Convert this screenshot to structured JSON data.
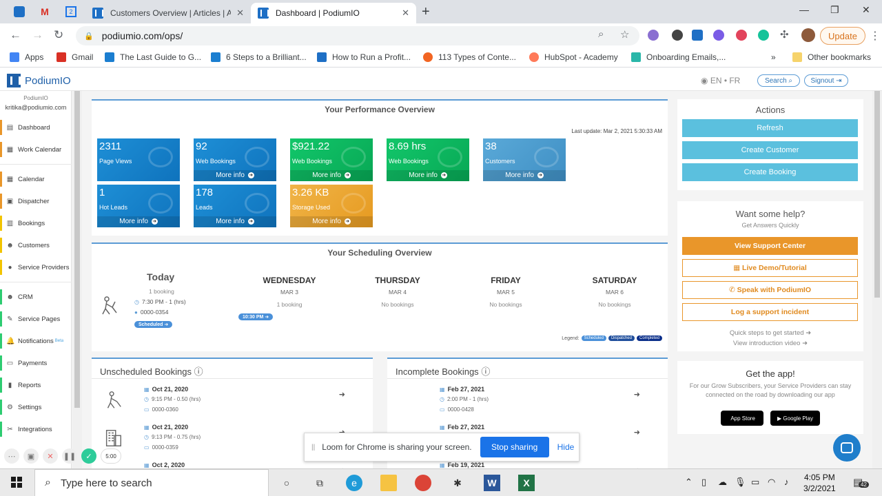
{
  "browser": {
    "tabs": [
      {
        "title": "Customers Overview | Articles | A"
      },
      {
        "title": "Dashboard | PodiumIO"
      }
    ],
    "url": "podiumio.com/ops/",
    "update_label": "Update",
    "bookmarks": [
      "Apps",
      "Gmail",
      "The Last Guide to G...",
      "6 Steps to a Brilliant...",
      "How to Run a Profit...",
      "113 Types of Conte...",
      "HubSpot - Academy",
      "Onboarding Emails,...",
      "Other bookmarks"
    ]
  },
  "app": {
    "logo": "PodiumIO",
    "lang": "EN • FR",
    "search_label": "Search",
    "signout_label": "Signout"
  },
  "sidebar": {
    "org": "PodiumIO",
    "email": "kritika@podiumio.com",
    "items": [
      {
        "label": "Dashboard",
        "color": "#e9962a"
      },
      {
        "label": "Work Calendar",
        "color": "#e9962a"
      },
      {
        "label": "Calendar",
        "color": "#e9962a"
      },
      {
        "label": "Dispatcher",
        "color": "#e9962a"
      },
      {
        "label": "Bookings",
        "color": "#f2c400"
      },
      {
        "label": "Customers",
        "color": "#f2c400"
      },
      {
        "label": "Service Providers",
        "color": "#f2c400"
      },
      {
        "label": "CRM",
        "color": "#2ecc71"
      },
      {
        "label": "Service Pages",
        "color": "#2ecc71"
      },
      {
        "label": "Notifications",
        "color": "#2ecc71",
        "badge": "Beta"
      },
      {
        "label": "Payments",
        "color": "#2ecc71"
      },
      {
        "label": "Reports",
        "color": "#2ecc71"
      },
      {
        "label": "Settings",
        "color": "#2ecc71"
      },
      {
        "label": "Integrations",
        "color": "#2ecc71"
      }
    ]
  },
  "performance": {
    "title": "Your Performance Overview",
    "last_update": "Last update: Mar 2, 2021 5:30:33 AM",
    "more_info": "More info",
    "tiles": [
      {
        "value": "2311",
        "label": "Page Views",
        "style": "blue"
      },
      {
        "value": "92",
        "label": "Web Bookings",
        "style": "blue"
      },
      {
        "value": "$921.22",
        "label": "Web Bookings",
        "style": "green"
      },
      {
        "value": "8.69 hrs",
        "label": "Web Bookings",
        "style": "green"
      },
      {
        "value": "38",
        "label": "Customers",
        "style": "lightblue"
      },
      {
        "value": "1",
        "label": "Hot Leads",
        "style": "blue"
      },
      {
        "value": "178",
        "label": "Leads",
        "style": "blue"
      },
      {
        "value": "3.26 KB",
        "label": "Storage Used",
        "style": "orange"
      }
    ]
  },
  "scheduling": {
    "title": "Your Scheduling Overview",
    "today": {
      "label": "Today",
      "count": "1 booking",
      "time": "7:30 PM - 1 (hrs)",
      "code": "0000-0354",
      "badge": "Scheduled"
    },
    "days": [
      {
        "name": "WEDNESDAY",
        "date": "MAR 3",
        "count": "1 booking",
        "badge": "10:30 PM"
      },
      {
        "name": "THURSDAY",
        "date": "MAR 4",
        "count": "No bookings"
      },
      {
        "name": "FRIDAY",
        "date": "MAR 5",
        "count": "No bookings"
      },
      {
        "name": "SATURDAY",
        "date": "MAR 6",
        "count": "No bookings"
      }
    ],
    "legend_label": "Legend:",
    "legend": [
      {
        "label": "Scheduled",
        "color": "#4a90d9"
      },
      {
        "label": "Dispatched",
        "color": "#1f4e9c"
      },
      {
        "label": "Completed",
        "color": "#0b2f8a"
      }
    ]
  },
  "unscheduled": {
    "title": "Unscheduled Bookings",
    "rows": [
      {
        "date": "Oct 21, 2020",
        "time": "9:15 PM - 0.50 (hrs)",
        "code": "0000-0360"
      },
      {
        "date": "Oct 21, 2020",
        "time": "9:13 PM - 0.75 (hrs)",
        "code": "0000-0359"
      },
      {
        "date": "Oct 2, 2020",
        "time": "",
        "code": ""
      }
    ]
  },
  "incomplete": {
    "title": "Incomplete Bookings",
    "rows": [
      {
        "date": "Feb 27, 2021",
        "time": "2:00 PM - 1 (hrs)",
        "code": "0000-0428"
      },
      {
        "date": "Feb 27, 2021",
        "time": "",
        "code": ""
      },
      {
        "date": "Feb 19, 2021",
        "time": "",
        "code": ""
      }
    ]
  },
  "actions": {
    "title": "Actions",
    "buttons": [
      "Refresh",
      "Create Customer",
      "Create Booking"
    ]
  },
  "help": {
    "title": "Want some help?",
    "subtitle": "Get Answers Quickly",
    "support": "View Support Center",
    "demo": "Live Demo/Tutorial",
    "speak": "Speak with PodiumIO",
    "incident": "Log a support incident",
    "quick_steps": "Quick steps to get started",
    "intro_video": "View introduction video"
  },
  "getapp": {
    "title": "Get the app!",
    "text": "For our Grow Subscribers, your Service Providers can stay connected on the road by downloading our app",
    "appstore": "App Store",
    "googleplay": "Google Play"
  },
  "loom": {
    "timer": "5:00",
    "share_text": "Loom for Chrome is sharing your screen.",
    "stop": "Stop sharing",
    "hide": "Hide"
  },
  "taskbar": {
    "search_placeholder": "Type here to search",
    "time": "4:05 PM",
    "date": "3/2/2021",
    "notifications": "42"
  }
}
